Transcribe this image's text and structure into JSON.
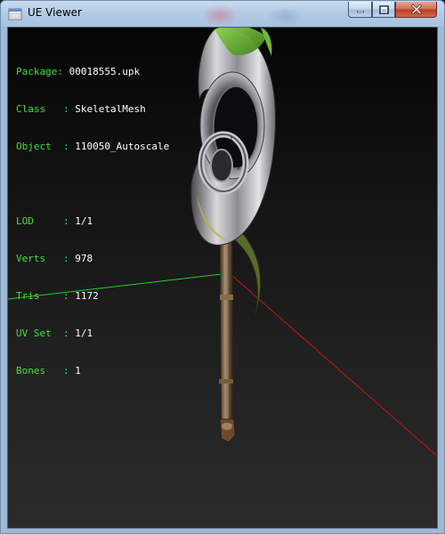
{
  "window": {
    "title": "UE Viewer",
    "icon": "ue-viewer-app-icon",
    "controls": {
      "minimize_icon": "minimize-icon",
      "maximize_icon": "maximize-icon",
      "close_icon": "close-icon"
    }
  },
  "info_panel": {
    "package": {
      "label": "Package: ",
      "value": "00018555.upk"
    },
    "class": {
      "label": "Class   : ",
      "value": "SkeletalMesh"
    },
    "object": {
      "label": "Object  : ",
      "value": "110050_Autoscale"
    },
    "lod": {
      "label": "LOD     : ",
      "value": "1/1"
    },
    "verts": {
      "label": "Verts   : ",
      "value": "978"
    },
    "tris": {
      "label": "Tris    : ",
      "value": "1172"
    },
    "uvset": {
      "label": "UV Set  : ",
      "value": "1/1"
    },
    "bones": {
      "label": "Bones   : ",
      "value": "1"
    }
  },
  "colors": {
    "label_green": "#3fe23f",
    "value_white": "#ffffff",
    "axis_x_red": "#c81414",
    "axis_y_green": "#1ed21e",
    "axis_z_blue": "#2a3cd8"
  },
  "scene": {
    "mesh": "scythe-mesh",
    "axes": [
      "x-axis",
      "y-axis",
      "z-axis"
    ]
  }
}
